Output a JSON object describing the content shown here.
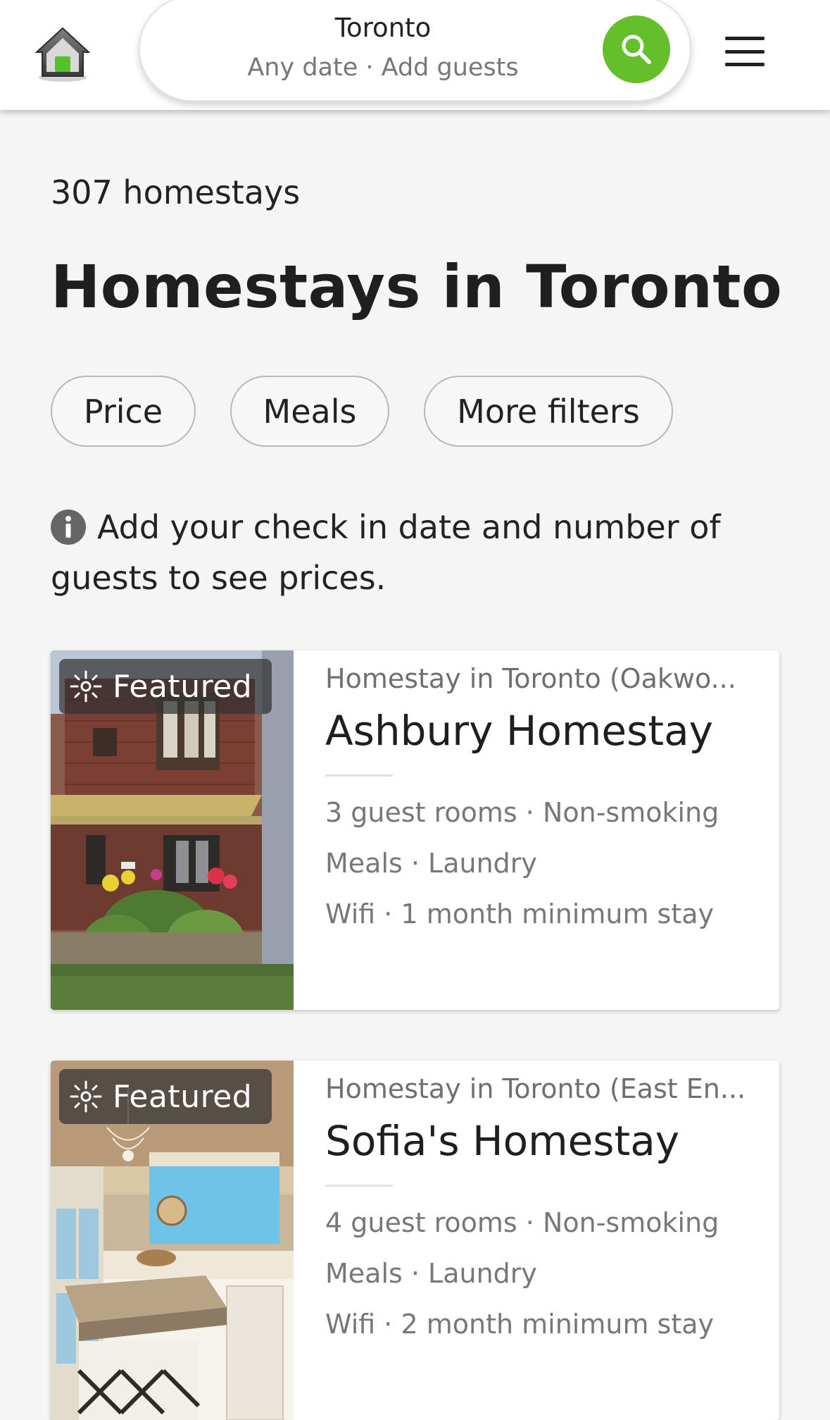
{
  "header": {
    "city": "Toronto",
    "subtitle": "Any date · Add guests"
  },
  "results": {
    "count": "307 homestays",
    "title": "Homestays in Toronto"
  },
  "filters": [
    "Price",
    "Meals",
    "More filters"
  ],
  "notice": "Add your check in date and number of guests to see prices.",
  "listings": [
    {
      "badge": "Featured",
      "kicker": "Homestay in Toronto (Oakwo...",
      "title": "Ashbury Homestay",
      "line1": "3 guest rooms · Non-smoking",
      "line2": "Meals · Laundry",
      "line3": "Wifi · 1 month minimum stay"
    },
    {
      "badge": "Featured",
      "kicker": "Homestay in Toronto (East En...",
      "title": "Sofia's Homestay",
      "line1": "4 guest rooms · Non-smoking",
      "line2": "Meals · Laundry",
      "line3": "Wifi · 2 month minimum stay"
    }
  ],
  "colors": {
    "accent": "#64bf2a",
    "background": "#f5f5f5"
  }
}
